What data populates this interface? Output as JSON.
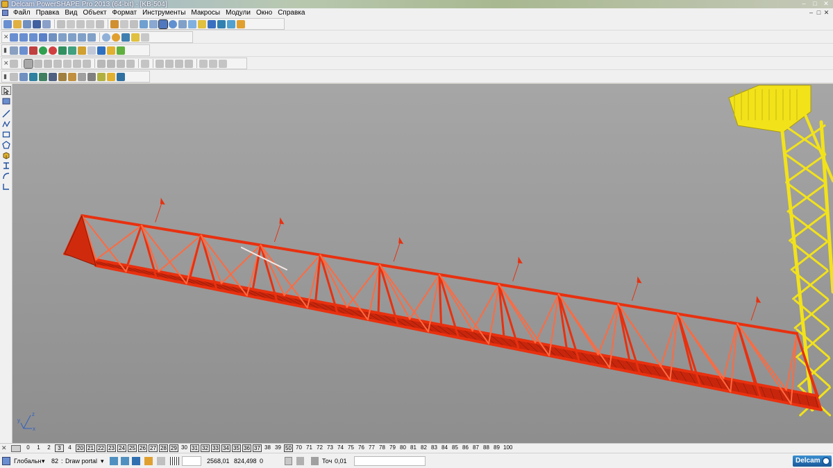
{
  "titlebar": {
    "title": "Delcam PowerSHAPE Pro 2013 (64-bit) - [KB-504]",
    "minimize": "–",
    "maximize": "□",
    "close": "✕"
  },
  "menubar": {
    "items": [
      "Файл",
      "Правка",
      "Вид",
      "Объект",
      "Формат",
      "Инструменты",
      "Макросы",
      "Модули",
      "Окно",
      "Справка"
    ]
  },
  "viewport": {
    "background_top": "#a6a6a6",
    "background_bottom": "#8e8e8e",
    "jib_color": "#e8300f",
    "tower_color": "#f2e21a",
    "axis_labels": {
      "x": "x",
      "y": "y",
      "z": "z"
    }
  },
  "levels": {
    "items": [
      {
        "label": "0",
        "on": false
      },
      {
        "label": "1",
        "on": false
      },
      {
        "label": "2",
        "on": false
      },
      {
        "label": "3",
        "on": true
      },
      {
        "label": "4",
        "on": false
      },
      {
        "label": "20",
        "on": true
      },
      {
        "label": "21",
        "on": true
      },
      {
        "label": "22",
        "on": true
      },
      {
        "label": "23",
        "on": true
      },
      {
        "label": "24",
        "on": true
      },
      {
        "label": "25",
        "on": true
      },
      {
        "label": "26",
        "on": true
      },
      {
        "label": "27",
        "on": true
      },
      {
        "label": "28",
        "on": true
      },
      {
        "label": "29",
        "on": true
      },
      {
        "label": "30",
        "on": false
      },
      {
        "label": "31",
        "on": true
      },
      {
        "label": "32",
        "on": true
      },
      {
        "label": "33",
        "on": true
      },
      {
        "label": "34",
        "on": true
      },
      {
        "label": "35",
        "on": true
      },
      {
        "label": "36",
        "on": true
      },
      {
        "label": "37",
        "on": true
      },
      {
        "label": "38",
        "on": false
      },
      {
        "label": "39",
        "on": false
      },
      {
        "label": "50",
        "on": true
      },
      {
        "label": "70",
        "on": false
      },
      {
        "label": "71",
        "on": false
      },
      {
        "label": "72",
        "on": false
      },
      {
        "label": "73",
        "on": false
      },
      {
        "label": "74",
        "on": false
      },
      {
        "label": "75",
        "on": false
      },
      {
        "label": "76",
        "on": false
      },
      {
        "label": "77",
        "on": false
      },
      {
        "label": "78",
        "on": false
      },
      {
        "label": "79",
        "on": false
      },
      {
        "label": "80",
        "on": false
      },
      {
        "label": "81",
        "on": false
      },
      {
        "label": "82",
        "on": false
      },
      {
        "label": "83",
        "on": false
      },
      {
        "label": "84",
        "on": false
      },
      {
        "label": "85",
        "on": false
      },
      {
        "label": "86",
        "on": false
      },
      {
        "label": "87",
        "on": false
      },
      {
        "label": "88",
        "on": false
      },
      {
        "label": "89",
        "on": false
      },
      {
        "label": "100",
        "on": false
      }
    ]
  },
  "status": {
    "workplane": "Глобальн",
    "level_number": "82",
    "level_name": "Draw portal",
    "x_coord": "2568,01",
    "y_coord": "824,498",
    "z_coord": "0",
    "tolerance_label": "Точ",
    "tolerance_value": "0,01",
    "logo": "Delcam"
  }
}
